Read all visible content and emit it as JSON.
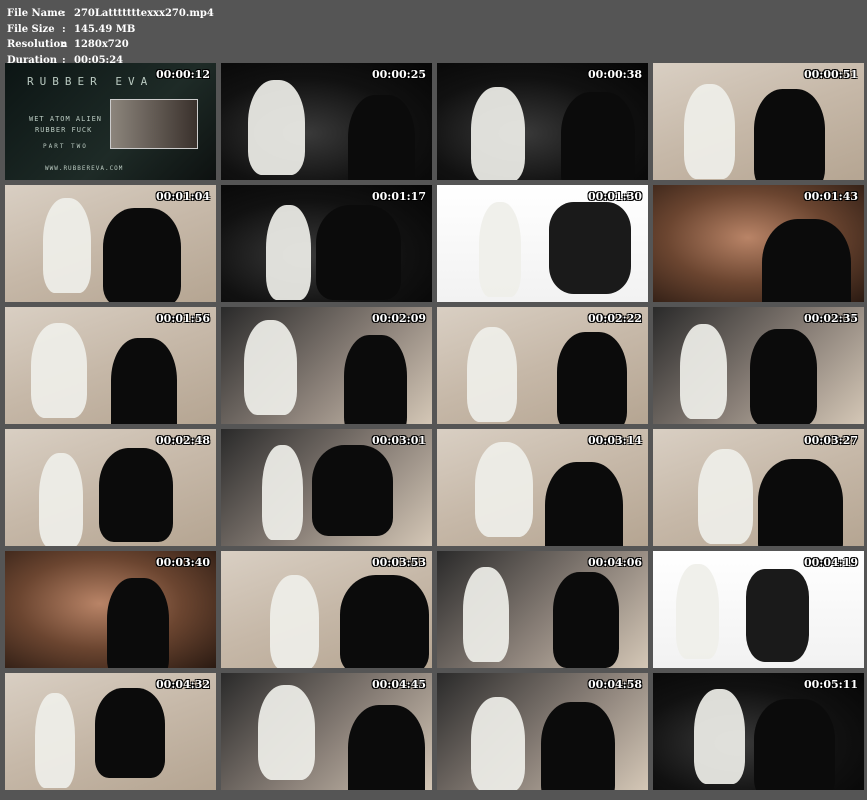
{
  "meta": {
    "rows": [
      {
        "key": "File Name",
        "sep": ":",
        "value": "270Latttttttexxx270.mp4"
      },
      {
        "key": "File Size",
        "sep": ":",
        "value": "145.49 MB"
      },
      {
        "key": "Resolution",
        "sep": ":",
        "value": "1280x720"
      },
      {
        "key": "Duration",
        "sep": ":",
        "value": "00:05:24"
      }
    ]
  },
  "title_card": {
    "brand": "RUBBER EVA",
    "line1": "WET ATOM ALIEN",
    "line2": "RUBBER FUCK",
    "line3": "PART TWO",
    "url": "WWW.RUBBEREVA.COM"
  },
  "thumbnails": [
    {
      "time": "00:00:12",
      "scene": "title"
    },
    {
      "time": "00:00:25",
      "scene": "dark"
    },
    {
      "time": "00:00:38",
      "scene": "dark"
    },
    {
      "time": "00:00:51",
      "scene": "tile"
    },
    {
      "time": "00:01:04",
      "scene": "tile"
    },
    {
      "time": "00:01:17",
      "scene": "dark"
    },
    {
      "time": "00:01:30",
      "scene": "white"
    },
    {
      "time": "00:01:43",
      "scene": "face"
    },
    {
      "time": "00:01:56",
      "scene": "tile"
    },
    {
      "time": "00:02:09",
      "scene": "mix"
    },
    {
      "time": "00:02:22",
      "scene": "tile"
    },
    {
      "time": "00:02:35",
      "scene": "mix"
    },
    {
      "time": "00:02:48",
      "scene": "tile"
    },
    {
      "time": "00:03:01",
      "scene": "mix"
    },
    {
      "time": "00:03:14",
      "scene": "tile"
    },
    {
      "time": "00:03:27",
      "scene": "tile"
    },
    {
      "time": "00:03:40",
      "scene": "face"
    },
    {
      "time": "00:03:53",
      "scene": "tile"
    },
    {
      "time": "00:04:06",
      "scene": "mix"
    },
    {
      "time": "00:04:19",
      "scene": "white"
    },
    {
      "time": "00:04:32",
      "scene": "tile"
    },
    {
      "time": "00:04:45",
      "scene": "mix"
    },
    {
      "time": "00:04:58",
      "scene": "mix"
    },
    {
      "time": "00:05:11",
      "scene": "dark"
    }
  ]
}
